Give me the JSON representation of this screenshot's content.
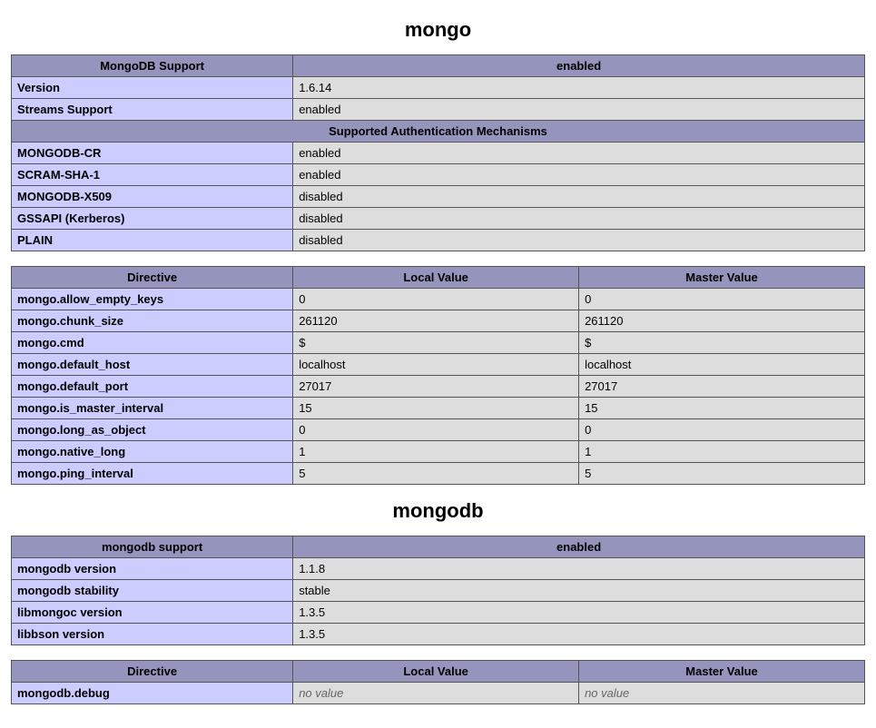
{
  "mongo": {
    "heading": "mongo",
    "support_table": {
      "header": [
        "MongoDB Support",
        "enabled"
      ],
      "rows": [
        {
          "key": "Version",
          "val": "1.6.14"
        },
        {
          "key": "Streams Support",
          "val": "enabled"
        }
      ],
      "subheader": "Supported Authentication Mechanisms",
      "auth_rows": [
        {
          "key": "MONGODB-CR",
          "val": "enabled"
        },
        {
          "key": "SCRAM-SHA-1",
          "val": "enabled"
        },
        {
          "key": "MONGODB-X509",
          "val": "disabled"
        },
        {
          "key": "GSSAPI (Kerberos)",
          "val": "disabled"
        },
        {
          "key": "PLAIN",
          "val": "disabled"
        }
      ]
    },
    "directive_table": {
      "header": [
        "Directive",
        "Local Value",
        "Master Value"
      ],
      "rows": [
        {
          "key": "mongo.allow_empty_keys",
          "local": "0",
          "master": "0"
        },
        {
          "key": "mongo.chunk_size",
          "local": "261120",
          "master": "261120"
        },
        {
          "key": "mongo.cmd",
          "local": "$",
          "master": "$"
        },
        {
          "key": "mongo.default_host",
          "local": "localhost",
          "master": "localhost"
        },
        {
          "key": "mongo.default_port",
          "local": "27017",
          "master": "27017"
        },
        {
          "key": "mongo.is_master_interval",
          "local": "15",
          "master": "15"
        },
        {
          "key": "mongo.long_as_object",
          "local": "0",
          "master": "0"
        },
        {
          "key": "mongo.native_long",
          "local": "1",
          "master": "1"
        },
        {
          "key": "mongo.ping_interval",
          "local": "5",
          "master": "5"
        }
      ]
    }
  },
  "mongodb": {
    "heading": "mongodb",
    "support_table": {
      "header": [
        "mongodb support",
        "enabled"
      ],
      "rows": [
        {
          "key": "mongodb version",
          "val": "1.1.8"
        },
        {
          "key": "mongodb stability",
          "val": "stable"
        },
        {
          "key": "libmongoc version",
          "val": "1.3.5"
        },
        {
          "key": "libbson version",
          "val": "1.3.5"
        }
      ]
    },
    "directive_table": {
      "header": [
        "Directive",
        "Local Value",
        "Master Value"
      ],
      "rows": [
        {
          "key": "mongodb.debug",
          "local": "no value",
          "master": "no value",
          "novalue": true
        }
      ]
    }
  }
}
